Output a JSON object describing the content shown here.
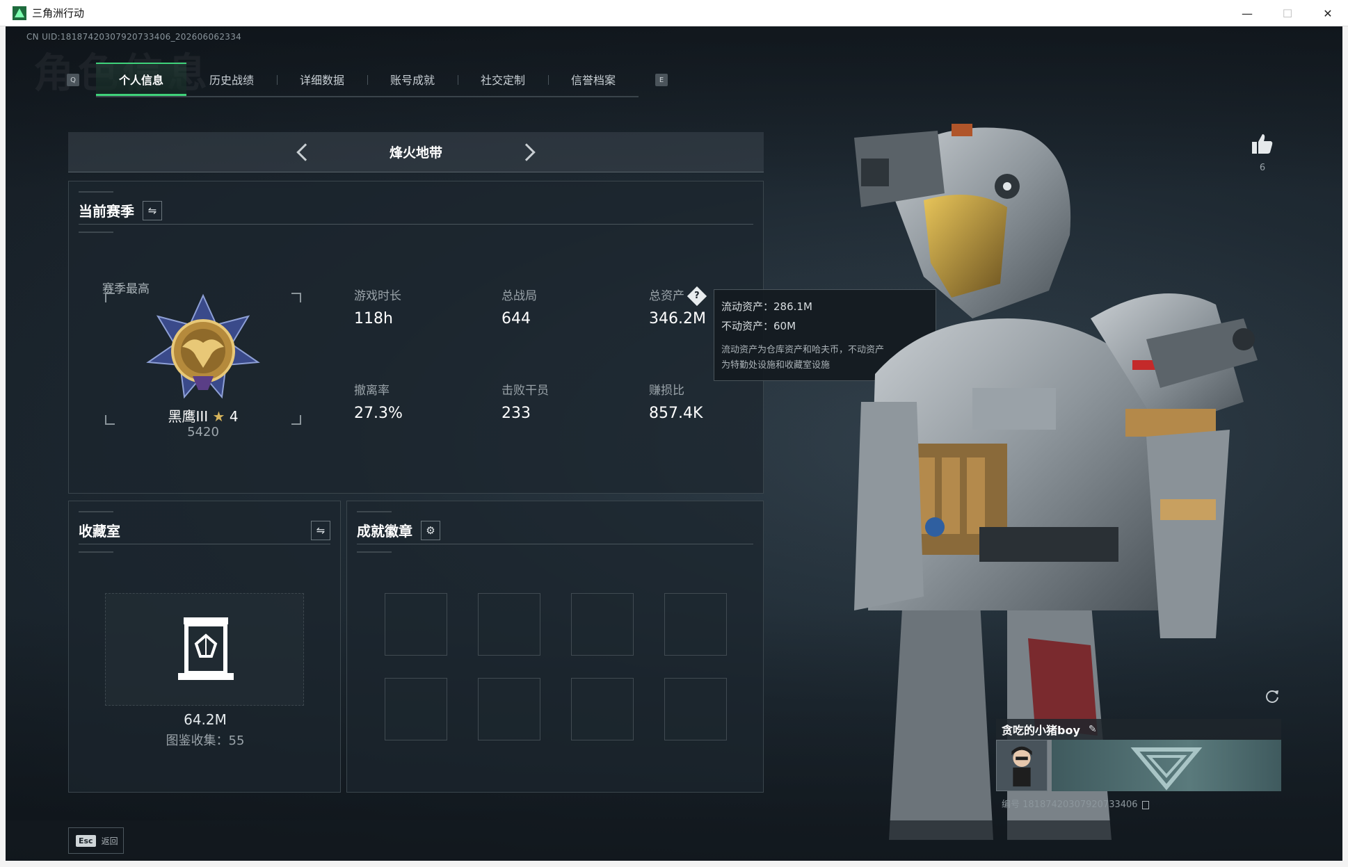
{
  "window": {
    "title": "三角洲行动",
    "controls": {
      "minimize": "—",
      "maximize": "☐",
      "close": "✕"
    }
  },
  "header": {
    "uid_text": "CN UID:18187420307920733406_202606062334",
    "bg_watermark": "角色信息"
  },
  "tabs": {
    "prev_key": "Q",
    "next_key": "E",
    "items": [
      {
        "label": "个人信息",
        "active": true
      },
      {
        "label": "历史战绩",
        "active": false
      },
      {
        "label": "详细数据",
        "active": false
      },
      {
        "label": "账号成就",
        "active": false
      },
      {
        "label": "社交定制",
        "active": false
      },
      {
        "label": "信誉档案",
        "active": false
      }
    ]
  },
  "mode": {
    "title": "烽火地带"
  },
  "season": {
    "title": "当前赛季",
    "switch_icon": "swap-icon",
    "rank_label": "赛季最高",
    "rank_name": "黑鹰III",
    "rank_stars": "4",
    "rank_score": "5420",
    "stats": [
      {
        "label": "游戏时长",
        "value": "118h"
      },
      {
        "label": "总战局",
        "value": "644"
      },
      {
        "label": "总资产",
        "value": "346.2M",
        "has_help": true
      },
      {
        "label": "撤离率",
        "value": "27.3%"
      },
      {
        "label": "击败干员",
        "value": "233"
      },
      {
        "label": "赚损比",
        "value": "857.4K"
      }
    ],
    "help_icon_glyph": "?"
  },
  "tooltip": {
    "liquid": "流动资产：286.1M",
    "fixed": "不动资产：60M",
    "desc_line1": "流动资产为仓库资产和哈夫币，不动资产",
    "desc_line2": "为特勤处设施和收藏室设施"
  },
  "collection": {
    "title": "收藏室",
    "value": "64.2M",
    "count_text": "图鉴收集：55"
  },
  "badges": {
    "title": "成就徽章",
    "slots": 8
  },
  "character": {
    "like_count": "6"
  },
  "player": {
    "name": "贪吃的小猪boy",
    "id_text": "编号 18187420307920733406"
  },
  "footer": {
    "esc_key": "Esc",
    "back_label": "返回"
  },
  "colors": {
    "accent": "#3fd27a",
    "rank_gold": "#d6b45c",
    "panel_bg": "#1c262e"
  }
}
